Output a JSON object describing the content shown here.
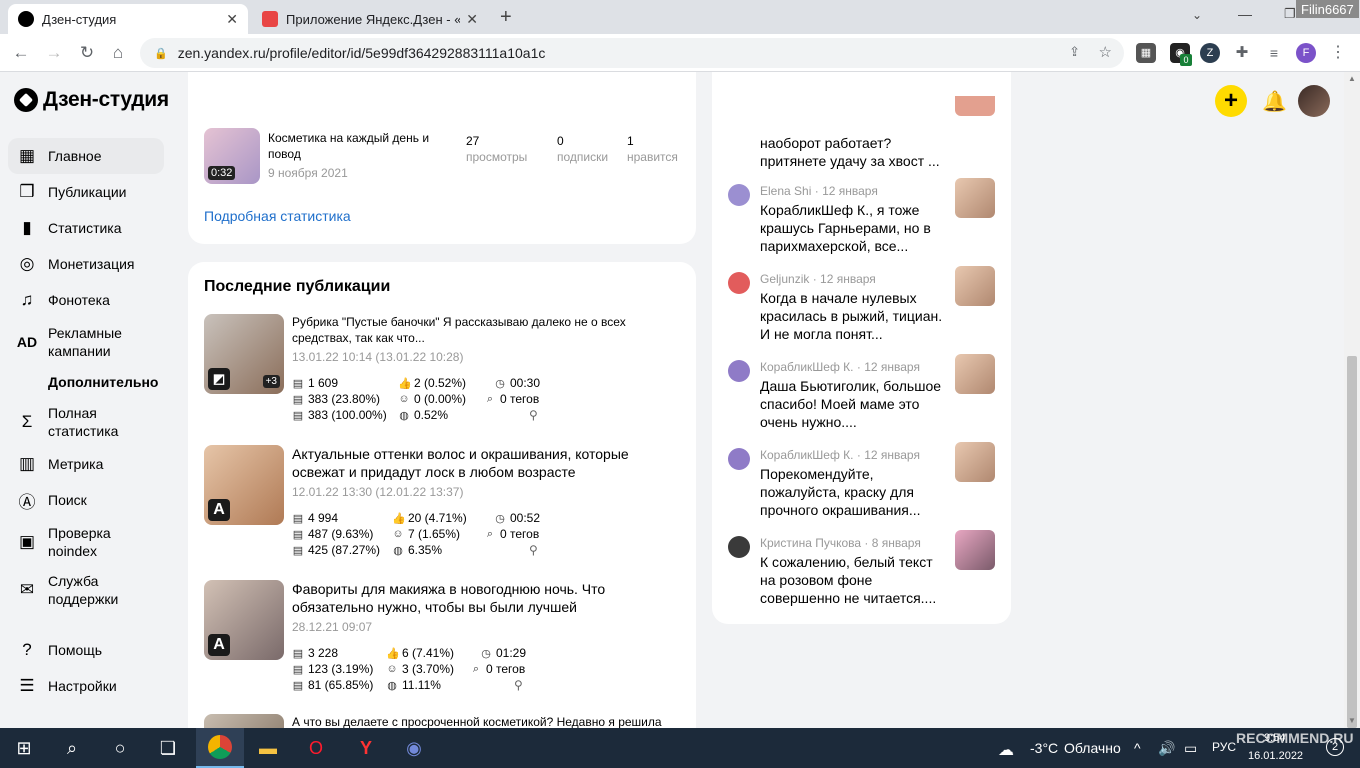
{
  "browser": {
    "tabs": [
      {
        "title": "Дзен-студия",
        "close": "✕",
        "active": true
      },
      {
        "title": "Приложение Яндекс.Дзен - «Те",
        "close": "✕",
        "active": false
      }
    ],
    "new_tab": "+",
    "url": "zen.yandex.ru/profile/editor/id/5e99df364292883111a10a1c",
    "profile_letter": "F",
    "watermark_user": "Filin6667",
    "ext_badge": "0"
  },
  "header": {
    "logo": "Дзен-студия",
    "plus": "+"
  },
  "sidebar": {
    "items": [
      {
        "label": "Главное",
        "icon": "home-icon",
        "active": true
      },
      {
        "label": "Публикации",
        "icon": "publications-icon"
      },
      {
        "label": "Статистика",
        "icon": "stats-icon"
      },
      {
        "label": "Монетизация",
        "icon": "money-icon"
      },
      {
        "label": "Фонотека",
        "icon": "music-icon"
      },
      {
        "label": "Рекламные кампании",
        "icon": "ad-icon",
        "glyph": "AD"
      },
      {
        "label": "Полная статистика",
        "icon": "sigma-icon"
      },
      {
        "label": "Метрика",
        "icon": "metrics-icon"
      },
      {
        "label": "Поиск",
        "icon": "search-icon"
      },
      {
        "label": "Проверка noindex",
        "icon": "noindex-icon"
      },
      {
        "label": "Служба поддержки",
        "icon": "mail-icon"
      },
      {
        "label": "Помощь",
        "icon": "help-icon"
      },
      {
        "label": "Настройки",
        "icon": "settings-icon"
      }
    ],
    "section_header": "Дополнительно"
  },
  "top_card": {
    "item_title": "Косметика на каждый день и повод",
    "item_date": "9 ноября 2021",
    "video_duration": "0:32",
    "stats": [
      {
        "value": "27",
        "label": "просмотры"
      },
      {
        "value": "0",
        "label": "подписки"
      },
      {
        "value": "1",
        "label": "нравится"
      }
    ],
    "link": "Подробная статистика"
  },
  "publications": {
    "heading": "Последние публикации",
    "items": [
      {
        "title": "Рубрика \"Пустые баночки\" Я рассказываю далеко не о всех средствах, так как что...",
        "date": "13.01.22 10:14 (13.01.22 10:28)",
        "badge": "+3",
        "views": "1 609",
        "reads": "383 (23.80%)",
        "full": "383 (100.00%)",
        "likes": "2 (0.52%)",
        "comments": "0 (0.00%)",
        "ctr": "0.52%",
        "time": "00:30",
        "tags": "0 тегов"
      },
      {
        "title": "Актуальные оттенки волос и окрашивания, которые освежат и придадут лоск в любом возрасте",
        "date": "12.01.22 13:30 (12.01.22 13:37)",
        "badge": "A",
        "views": "4 994",
        "reads": "487 (9.63%)",
        "full": "425 (87.27%)",
        "likes": "20 (4.71%)",
        "comments": "7 (1.65%)",
        "ctr": "6.35%",
        "time": "00:52",
        "tags": "0 тегов"
      },
      {
        "title": "Фавориты для макияжа в новогоднюю ночь. Что обязательно нужно, чтобы вы были лучшей",
        "date": "28.12.21 09:07",
        "badge": "A",
        "views": "3 228",
        "reads": "123 (3.19%)",
        "full": "81 (65.85%)",
        "likes": "6 (7.41%)",
        "comments": "3 (3.70%)",
        "ctr": "11.11%",
        "time": "01:29",
        "tags": "0 тегов"
      },
      {
        "title": "А что вы делаете с просроченной косметикой? Недавно я решила"
      }
    ]
  },
  "comments": {
    "first_text": "наоборот работает? притянете удачу за хвост ...",
    "items": [
      {
        "author": "Elena Shi",
        "date": "12 января",
        "text": "КорабликШеф К., я тоже крашусь Гарньерами, но в парихмахерской, все..."
      },
      {
        "author": "Geljunzik",
        "date": "12 января",
        "text": "Когда в начале нулевых красилась в рыжий, тициан. И не могла понят..."
      },
      {
        "author": "КорабликШеф К.",
        "date": "12 января",
        "text": "Даша Бьютиголик, большое спасибо! Моей маме это очень нужно...."
      },
      {
        "author": "КорабликШеф К.",
        "date": "12 января",
        "text": "Порекомендуйте, пожалуйста, краску для прочного окрашивания..."
      },
      {
        "author": "Кристина Пучкова",
        "date": "8 января",
        "text": "К сожалению, белый текст на розовом фоне совершенно не читается...."
      }
    ],
    "separator": "·"
  },
  "taskbar": {
    "temperature": "-3°C",
    "weather": "Облачно",
    "lang": "РУС",
    "time": "9:54",
    "date": "16.01.2022",
    "notif_count": "2",
    "watermark": "RECOMMEND.RU"
  }
}
